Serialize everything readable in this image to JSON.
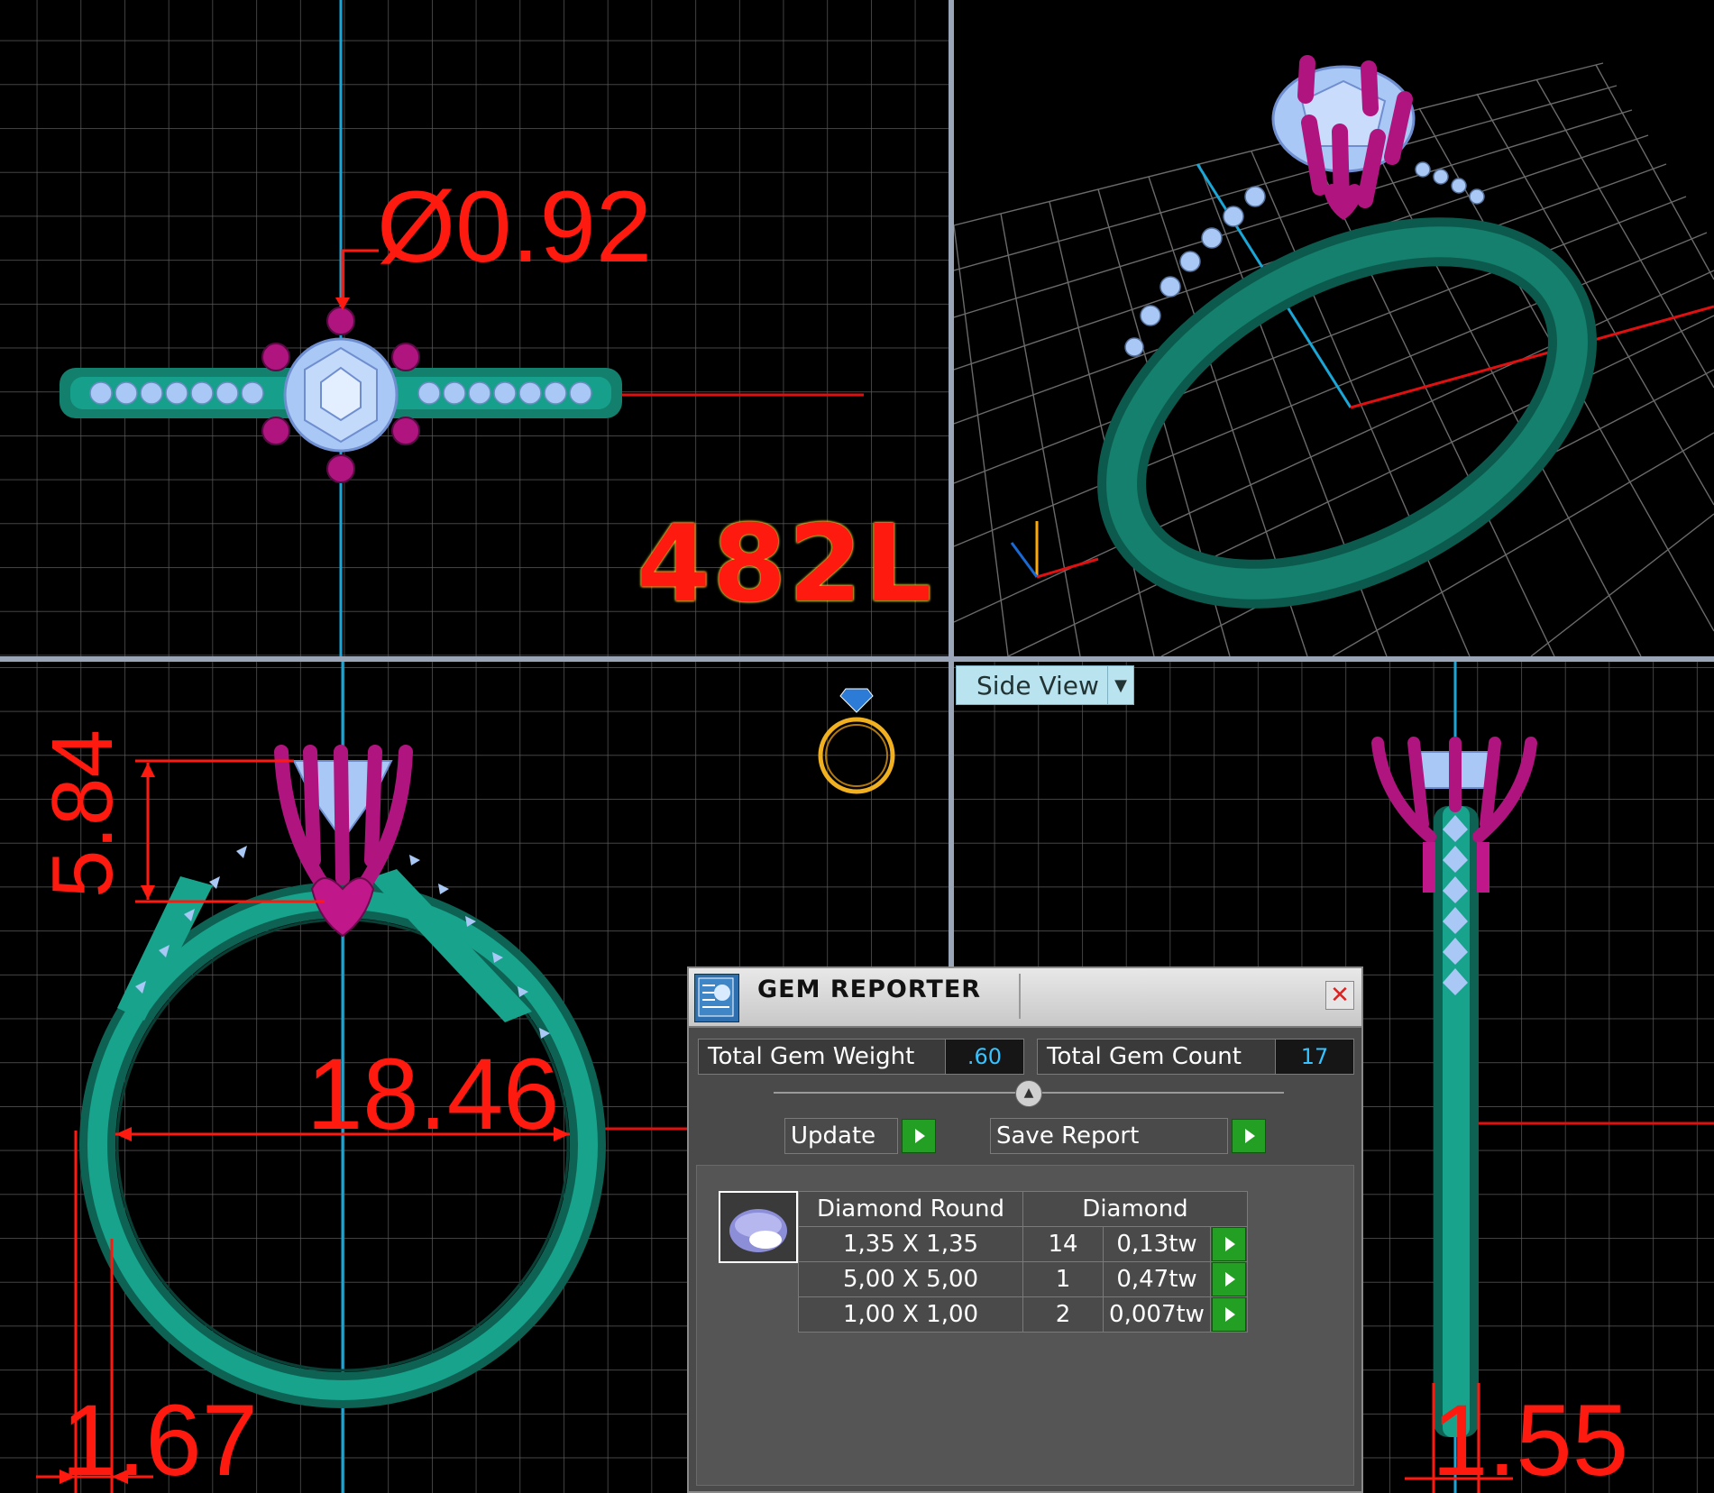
{
  "viewports": {
    "top_left": {
      "dimension_label": "Ø0.92",
      "model_label": "482L"
    },
    "bottom_left": {
      "height_dim": "5.84",
      "width_dim": "18.46",
      "band_dim": "1.67"
    },
    "bottom_right": {
      "view_selector": "Side View",
      "band_dim": "1.55"
    }
  },
  "gem_reporter": {
    "title": "GEM REPORTER",
    "total_weight_label": "Total Gem Weight",
    "total_weight_value": ".60",
    "total_count_label": "Total Gem Count",
    "total_count_value": "17",
    "update_label": "Update",
    "save_label": "Save Report",
    "columns": [
      "Diamond Round",
      "Diamond"
    ],
    "rows": [
      {
        "size": "1,35 X 1,35",
        "count": "14",
        "weight": "0,13tw"
      },
      {
        "size": "5,00 X 5,00",
        "count": "1",
        "weight": "0,47tw"
      },
      {
        "size": "1,00 X 1,00",
        "count": "2",
        "weight": "0,007tw"
      }
    ]
  },
  "colors": {
    "metal": "#13806e",
    "prongs": "#b0157f",
    "stones": "#a9c8f5",
    "dimension": "#ff1a10",
    "axis_blue": "#1aa6d6",
    "axis_red": "#e01010"
  }
}
